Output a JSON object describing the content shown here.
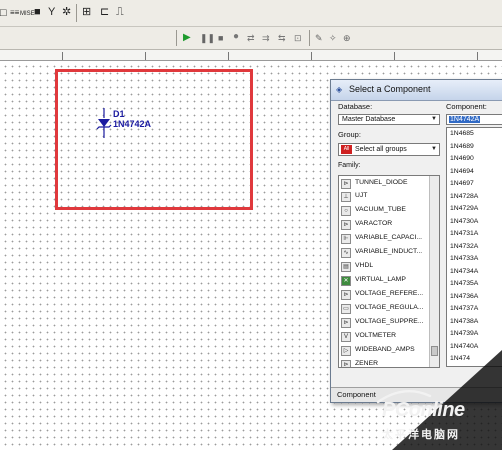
{
  "toolbar": {
    "mise_label": "MISE"
  },
  "schematic": {
    "ref_designator": "D1",
    "part_value": "1N4742A",
    "highlight_color": "#e0393d"
  },
  "dialog": {
    "title": "Select a Component",
    "database_label": "Database:",
    "database_value": "Master Database",
    "group_label": "Group:",
    "group_value": "Select all groups",
    "family_label": "Family:",
    "family_items": [
      "TUNNEL_DIODE",
      "UJT",
      "VACUUM_TUBE",
      "VARACTOR",
      "VARIABLE_CAPACI...",
      "VARIABLE_INDUCT...",
      "VHDL",
      "VIRTUAL_LAMP",
      "VOLTAGE_REFERE...",
      "VOLTAGE_REGULA...",
      "VOLTAGE_SUPPRE...",
      "VOLTMETER",
      "WIDEBAND_AMPS",
      "ZENER"
    ],
    "component_label": "Component:",
    "component_value": "1N4742A",
    "component_items": [
      "1N4685",
      "1N4689",
      "1N4690",
      "1N4694",
      "1N4697",
      "1N4728A",
      "1N4729A",
      "1N4730A",
      "1N4731A",
      "1N4732A",
      "1N4733A",
      "1N4734A",
      "1N4735A",
      "1N4736A",
      "1N4737A",
      "1N4738A",
      "1N4739A",
      "1N4740A",
      "1N474"
    ],
    "status_text": "Component"
  },
  "watermark": {
    "brand": "PConline",
    "subtitle": "太平洋电脑网"
  }
}
